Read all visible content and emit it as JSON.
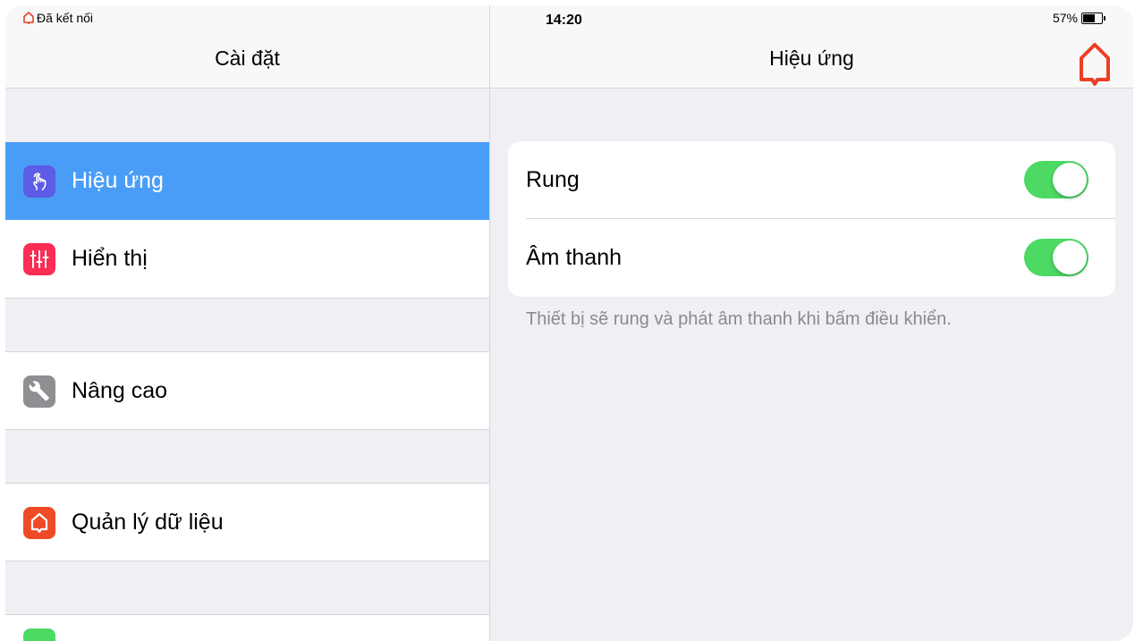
{
  "status_bar": {
    "carrier": "Đã kết nối",
    "time": "14:20",
    "battery": "57%",
    "battery_level": 0.57
  },
  "sidebar": {
    "title": "Cài đặt",
    "items": [
      {
        "label": "Hiệu ứng",
        "icon": "hand-tap-icon",
        "icon_color": "#5d5ce6",
        "selected": true
      },
      {
        "label": "Hiển thị",
        "icon": "sliders-icon",
        "icon_color": "#fb2d55",
        "selected": false
      },
      {
        "label": "Nâng cao",
        "icon": "wrench-icon",
        "icon_color": "#8e8e93",
        "selected": false
      },
      {
        "label": "Quản lý dữ liệu",
        "icon": "home-icon",
        "icon_color": "#ef4a26",
        "selected": false
      }
    ],
    "selected_color": "#4a9df7"
  },
  "detail": {
    "title": "Hiệu ứng",
    "home_icon": "home-icon",
    "settings": [
      {
        "label": "Rung",
        "on": true
      },
      {
        "label": "Âm thanh",
        "on": true
      }
    ],
    "footnote": "Thiết bị sẽ rung và phát âm thanh khi bấm điều khiển.",
    "toggle_on_color": "#4cd964"
  }
}
